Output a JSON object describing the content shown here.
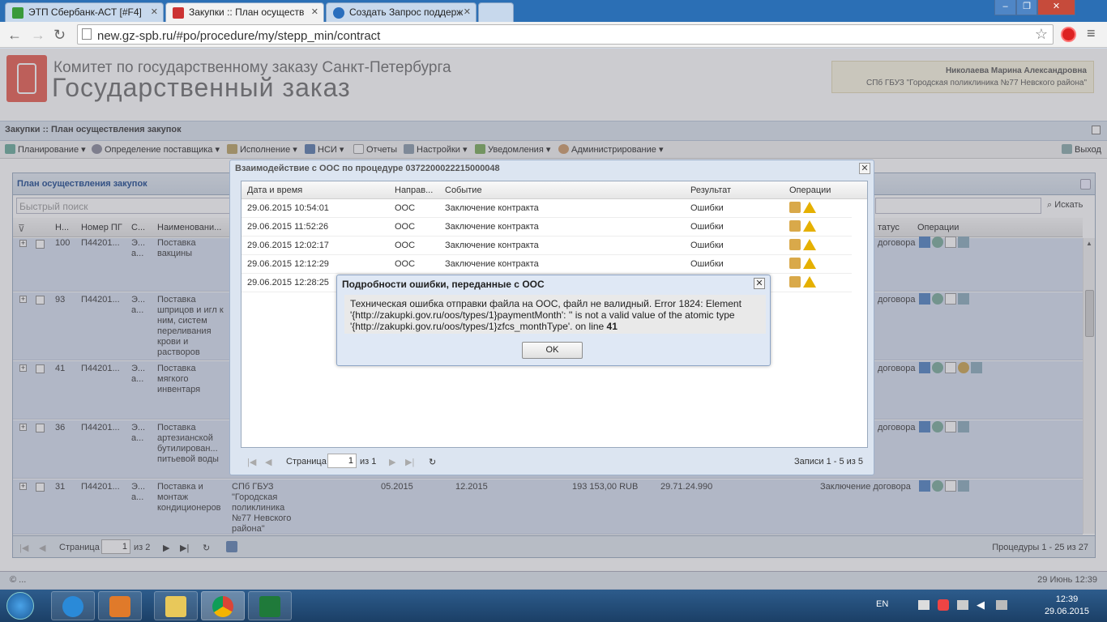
{
  "browser": {
    "tabs": [
      {
        "label": "ЭТП Сбербанк-АСТ [#F4]",
        "active": false
      },
      {
        "label": "Закупки :: План осуществ",
        "active": true
      },
      {
        "label": "Создать Запрос поддерж",
        "active": false
      }
    ],
    "url": "new.gz-spb.ru/#po/procedure/my/stepp_min/contract"
  },
  "header": {
    "line1": "Комитет по государственному заказу Санкт-Петербурга",
    "line2": "Государственный заказ",
    "user_name": "Николаева Марина Александровна",
    "user_org": "СПб ГБУЗ \"Городская поликлиника №77 Невского района\""
  },
  "breadcrumb": "Закупки :: План осуществления закупок",
  "menu": {
    "items": [
      "Планирование",
      "Определение поставщика",
      "Исполнение",
      "НСИ",
      "Отчеты",
      "Настройки",
      "Уведомления",
      "Администрирование"
    ],
    "exit": "Выход"
  },
  "panel": {
    "title": "План осуществления закупок",
    "quick_search_placeholder": "Быстрый поиск",
    "search_button": "Искать",
    "columns": [
      "Н...",
      "Номер ПГ",
      "С...",
      "Наименовани...",
      "татус",
      "Операции"
    ],
    "rows": [
      {
        "n": "100",
        "num": "П44201...",
        "s": "Э... а...",
        "name": "Поставка вакцины",
        "status": "договора"
      },
      {
        "n": "93",
        "num": "П44201...",
        "s": "Э... а...",
        "name": "Поставка шприцов и игл к ним, систем переливания крови и растворов",
        "status": "договора"
      },
      {
        "n": "41",
        "num": "П44201...",
        "s": "Э... а...",
        "name": "Поставка мягкого инвентаря",
        "status": "договора"
      },
      {
        "n": "36",
        "num": "П44201...",
        "s": "Э... а...",
        "name": "Поставка артезианской бутилирован... питьевой воды",
        "status": "договора"
      },
      {
        "n": "31",
        "num": "П44201...",
        "s": "Э... а...",
        "name": "Поставка и монтаж кондиционеров",
        "customer": "СПб ГБУЗ \"Городская поликлиника №77 Невского района\"",
        "start": "05.2015",
        "end": "12.2015",
        "sum": "193 153,00 RUB",
        "okpd": "29.71.24.990",
        "status": "Заключение договора"
      }
    ],
    "pager": {
      "page_label": "Страница",
      "page": "1",
      "of": "из 2",
      "summary": "Процедуры 1 - 25 из 27"
    }
  },
  "window": {
    "title": "Взаимодействие с ООС по процедуре 0372200022215000048",
    "columns": [
      "Дата и время",
      "Направ...",
      "Событие",
      "Результат",
      "Операции"
    ],
    "rows": [
      {
        "dt": "29.06.2015 10:54:01",
        "dir": "ООС",
        "event": "Заключение контракта",
        "result": "Ошибки"
      },
      {
        "dt": "29.06.2015 11:52:26",
        "dir": "ООС",
        "event": "Заключение контракта",
        "result": "Ошибки"
      },
      {
        "dt": "29.06.2015 12:02:17",
        "dir": "ООС",
        "event": "Заключение контракта",
        "result": "Ошибки"
      },
      {
        "dt": "29.06.2015 12:12:29",
        "dir": "ООС",
        "event": "Заключение контракта",
        "result": "Ошибки"
      },
      {
        "dt": "29.06.2015 12:28:25",
        "dir": "",
        "event": "",
        "result": ""
      }
    ],
    "pager": {
      "page_label": "Страница",
      "page": "1",
      "of": "из 1",
      "summary": "Записи 1 - 5 из 5"
    }
  },
  "dialog": {
    "title": "Подробности ошибки, переданные с ООС",
    "line1": "Техническая ошибка отправки файла на ООС, файл не валидный. Error 1824: Element",
    "line2": "'{http://zakupki.gov.ru/oos/types/1}paymentMonth': '' is not a valid value of the atomic type",
    "line3": "'{http://zakupki.gov.ru/oos/types/1}zfcs_monthType'. on line ",
    "line3_bold": "41",
    "ok": "OK"
  },
  "status": {
    "left": "© ...",
    "right": "29 Июнь 12:39"
  },
  "taskbar": {
    "lang": "EN",
    "time": "12:39",
    "date": "29.06.2015"
  }
}
